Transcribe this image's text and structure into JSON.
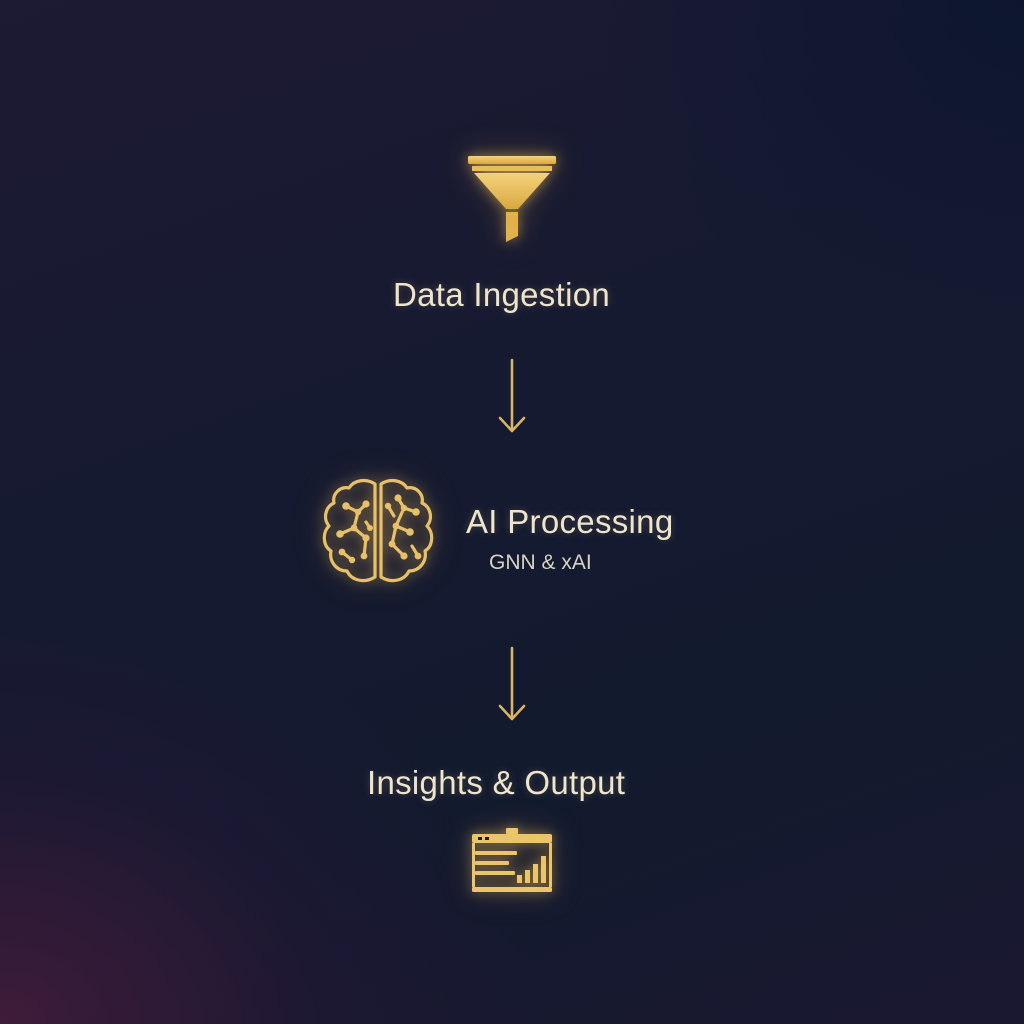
{
  "colors": {
    "accent": "#e9c873",
    "label": "#efe4cc",
    "background": "#161a30"
  },
  "steps": [
    {
      "icon": "funnel-icon",
      "label": "Data Ingestion"
    },
    {
      "icon": "brain-circuit-icon",
      "label": "AI Processing",
      "sublabel": "GNN & xAI"
    },
    {
      "icon": "dashboard-chart-icon",
      "label": "Insights & Output"
    }
  ],
  "connectors": [
    "arrow-down-icon",
    "arrow-down-icon"
  ]
}
